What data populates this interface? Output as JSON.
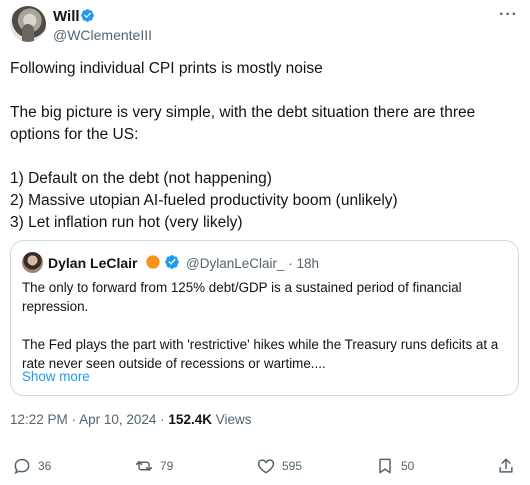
{
  "author": {
    "name": "Will",
    "handle": "@WClementeIII",
    "verified_color": "#1d9bf0"
  },
  "tweet": {
    "text": "Following individual CPI prints is mostly noise\n\nThe big picture is very simple, with the debt situation there are three options for the US:\n\n1) Default on the debt (not happening)\n2) Massive utopian AI-fueled productivity boom (unlikely)\n3) Let inflation run hot (very likely)"
  },
  "quote": {
    "name": "Dylan LeClair",
    "handle": "@DylanLeClair_",
    "sep": "·",
    "time": "18h",
    "text": "The only to forward from 125% debt/GDP is a sustained period of financial repression.\n\nThe Fed plays the part with 'restrictive' hikes while the Treasury runs deficits at a rate never seen outside of recessions or wartime....",
    "show_more": "Show more",
    "badge_color": "#f7931a"
  },
  "meta": {
    "time": "12:22 PM",
    "dot1": "·",
    "date": "Apr 10, 2024",
    "dot2": "·",
    "views_count": "152.4K",
    "views_label": "Views"
  },
  "actions": {
    "replies": "36",
    "reposts": "79",
    "likes": "595",
    "bookmarks": "50"
  },
  "icons": [
    "verified-badge-icon",
    "more-icon",
    "reply-icon",
    "repost-icon",
    "like-icon",
    "bookmark-icon",
    "share-icon"
  ]
}
